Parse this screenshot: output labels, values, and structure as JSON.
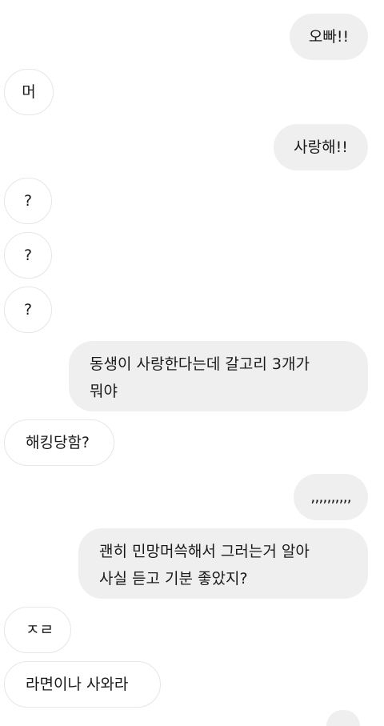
{
  "messages": [
    {
      "direction": "sent",
      "text": "오빠!!"
    },
    {
      "direction": "received",
      "text": "머"
    },
    {
      "direction": "sent",
      "text": "사랑해!!"
    },
    {
      "direction": "received",
      "text": "?"
    },
    {
      "direction": "received",
      "text": "?"
    },
    {
      "direction": "received",
      "text": "?"
    },
    {
      "direction": "sent",
      "text": "동생이 사랑한다는데 갈고리 3개가\n뭐야"
    },
    {
      "direction": "received",
      "text": "해킹당함?"
    },
    {
      "direction": "sent",
      "text": ",,,,,,,,,,"
    },
    {
      "direction": "sent",
      "text": "괜히 민망머쓱해서 그러는거 알아\n사실 듣고 기분 좋았지?"
    },
    {
      "direction": "received",
      "text": "ㅈㄹ"
    },
    {
      "direction": "received",
      "text": "라면이나 사와라"
    }
  ],
  "colors": {
    "sent_bubble": "#efefef",
    "received_bubble": "#ffffff",
    "received_border": "#e6e6e6",
    "text": "#1a1a1a",
    "background": "#ffffff"
  }
}
